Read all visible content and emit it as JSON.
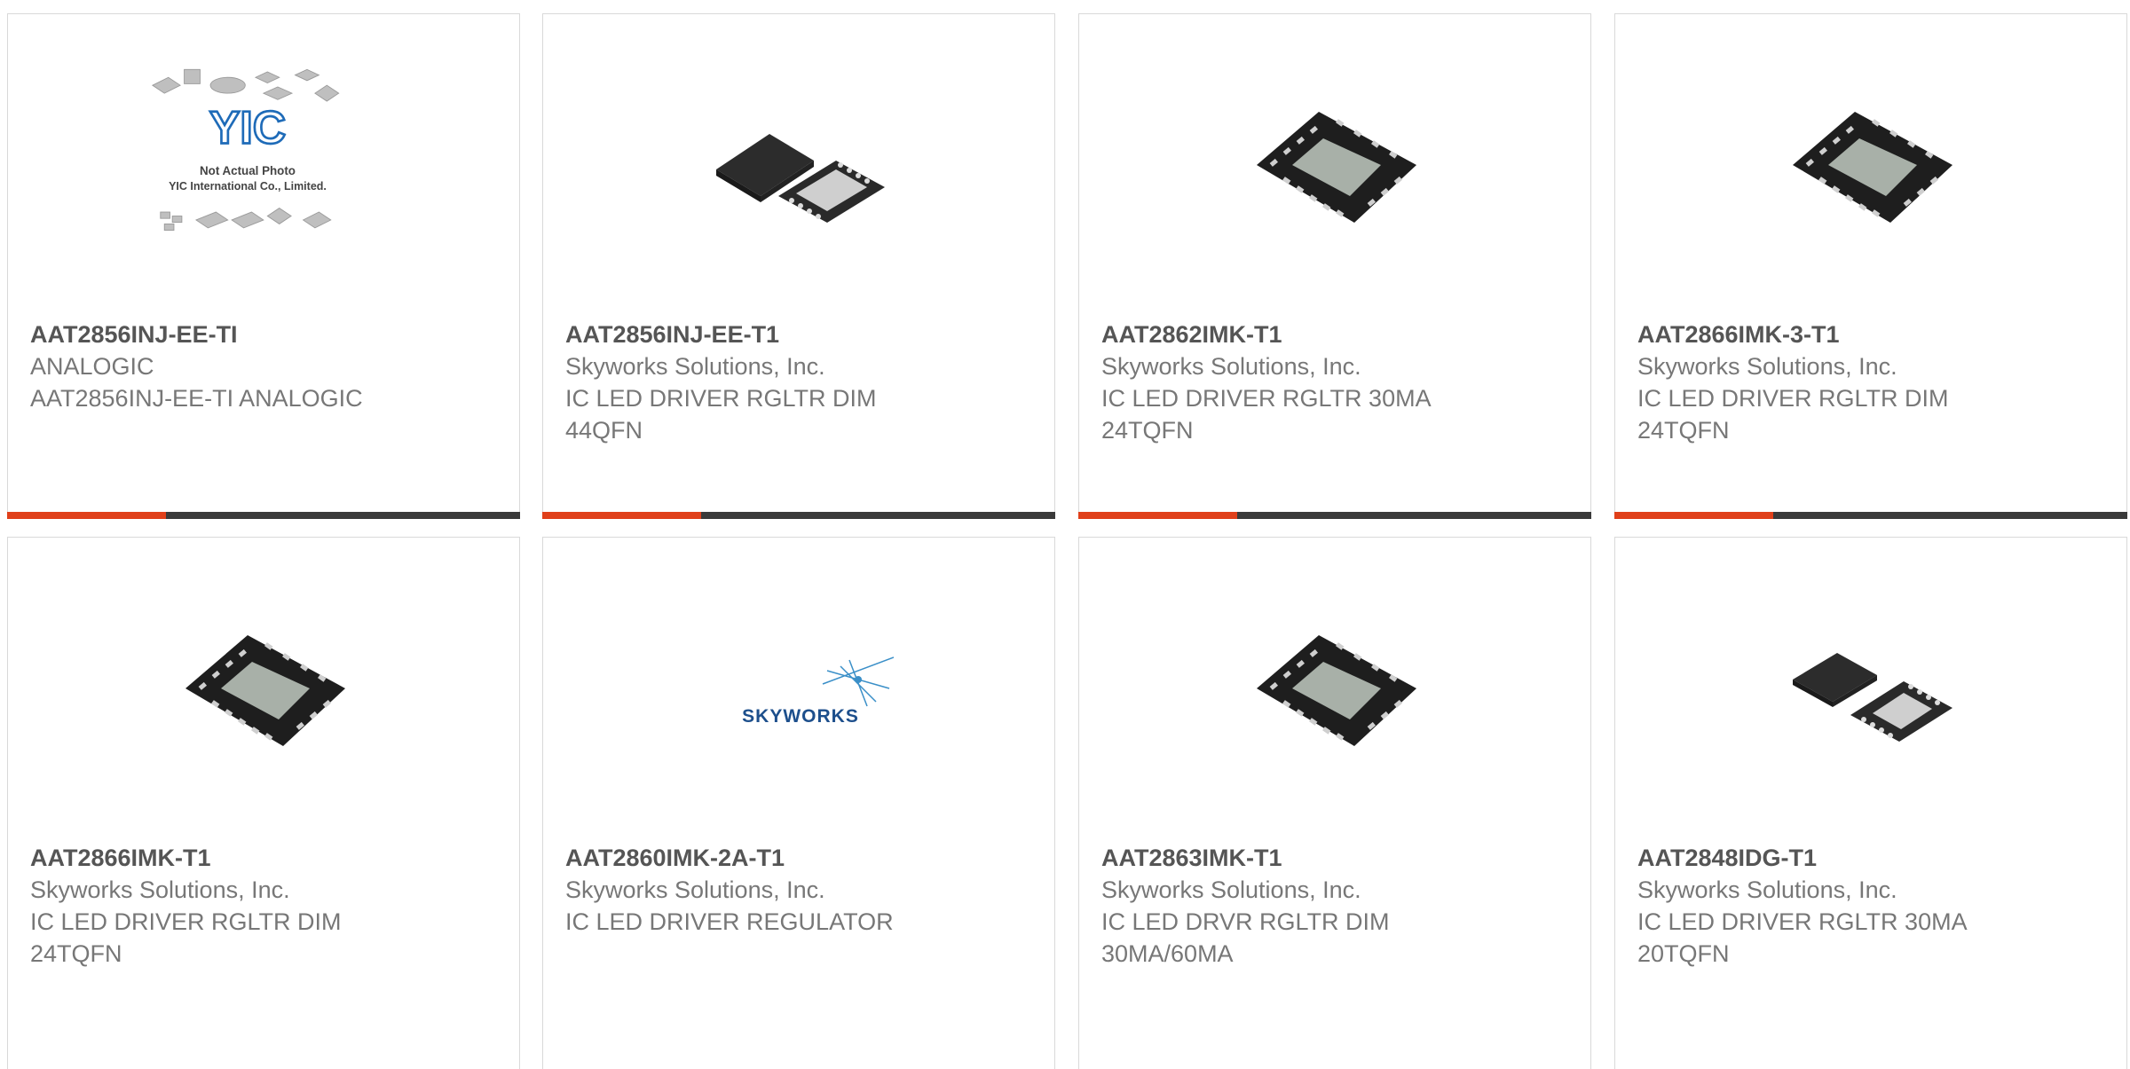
{
  "colors": {
    "accent": "#e0401a",
    "bar_dark": "#3a3a3a",
    "part_number": "#555555",
    "secondary_text": "#777777",
    "card_border": "#d9d9d9"
  },
  "products": [
    {
      "part_number": "AAT2856INJ-EE-TI",
      "manufacturer": "ANALOGIC",
      "description": "AAT2856INJ-EE-TI ANALOGIC",
      "image_icon": "placeholder-chips-icon",
      "image_caption_line1": "Not Actual Photo",
      "image_caption_line2": "YIC International Co., Limited.",
      "image_logo": "YIC",
      "progress": 0.31
    },
    {
      "part_number": "AAT2856INJ-EE-T1",
      "manufacturer": "Skyworks Solutions, Inc.",
      "description": "IC LED DRIVER RGLTR DIM\n44QFN",
      "image_icon": "qfn-chip-pair-icon",
      "progress": 0.31
    },
    {
      "part_number": "AAT2862IMK-T1",
      "manufacturer": "Skyworks Solutions, Inc.",
      "description": "IC LED DRIVER RGLTR 30MA\n24TQFN",
      "image_icon": "tqfn-chip-icon",
      "progress": 0.31
    },
    {
      "part_number": "AAT2866IMK-3-T1",
      "manufacturer": "Skyworks Solutions, Inc.",
      "description": "IC LED DRIVER RGLTR DIM\n24TQFN",
      "image_icon": "tqfn-chip-icon",
      "progress": 0.31
    },
    {
      "part_number": "AAT2866IMK-T1",
      "manufacturer": "Skyworks Solutions, Inc.",
      "description": "IC LED DRIVER RGLTR DIM\n24TQFN",
      "image_icon": "tqfn-chip-icon"
    },
    {
      "part_number": "AAT2860IMK-2A-T1",
      "manufacturer": "Skyworks Solutions, Inc.",
      "description": "IC LED DRIVER REGULATOR",
      "image_icon": "skyworks-logo-icon",
      "image_logo": "SKYWORKS"
    },
    {
      "part_number": "AAT2863IMK-T1",
      "manufacturer": "Skyworks Solutions, Inc.",
      "description": "IC LED DRVR RGLTR DIM\n30MA/60MA",
      "image_icon": "tqfn-chip-icon"
    },
    {
      "part_number": "AAT2848IDG-T1",
      "manufacturer": "Skyworks Solutions, Inc.",
      "description": "IC LED DRIVER RGLTR 30MA\n20TQFN",
      "image_icon": "qfn-chip-pair-icon"
    }
  ]
}
